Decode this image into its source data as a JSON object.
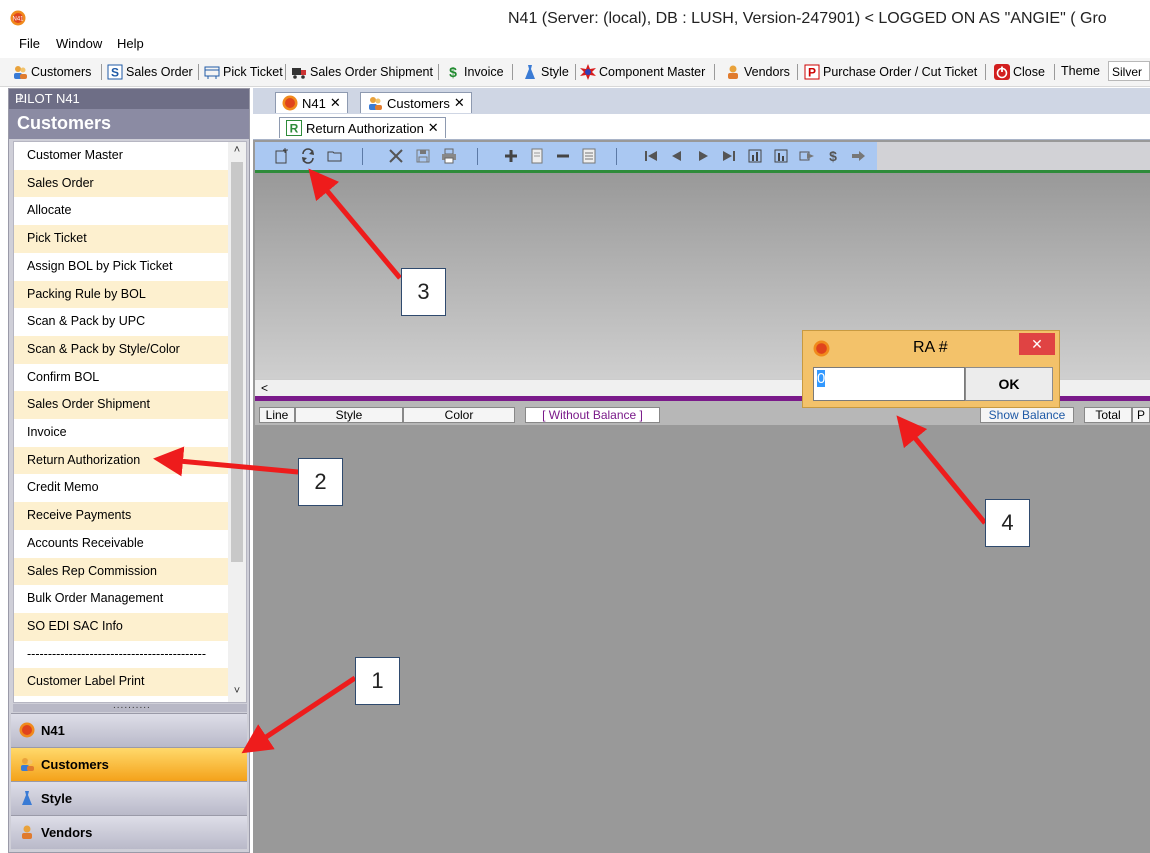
{
  "titlebar": {
    "text": "N41  (Server: (local), DB : LUSH, Version-247901)      < LOGGED ON AS \"ANGIE\" ( Gro"
  },
  "menubar": {
    "items": [
      "File",
      "Window",
      "Help"
    ]
  },
  "toolbar": {
    "items": [
      {
        "label": "Customers",
        "icon": "customers-icon"
      },
      {
        "label": "Sales Order",
        "icon": "sales-order-icon"
      },
      {
        "label": "Pick Ticket",
        "icon": "pick-ticket-icon"
      },
      {
        "label": "Sales Order Shipment",
        "icon": "shipment-icon"
      },
      {
        "label": "Invoice",
        "icon": "invoice-dollar-icon"
      },
      {
        "label": "Style",
        "icon": "style-dress-icon"
      },
      {
        "label": "Component Master",
        "icon": "component-icon"
      },
      {
        "label": "Vendors",
        "icon": "vendors-icon"
      },
      {
        "label": "Purchase Order / Cut Ticket",
        "icon": "purchase-order-icon"
      },
      {
        "label": "Close",
        "icon": "close-power-icon"
      }
    ],
    "theme_label": "Theme",
    "theme_value": "Silver"
  },
  "leftpane": {
    "header": "PILOT  N41",
    "pin": "⊥",
    "title": "Customers",
    "menu_items": [
      "Customer Master",
      "Sales Order",
      "Allocate",
      "Pick Ticket",
      "Assign BOL by Pick Ticket",
      "Packing Rule by BOL",
      "Scan & Pack by UPC",
      "Scan & Pack by Style/Color",
      "Confirm BOL",
      "Sales Order Shipment",
      "Invoice",
      "Return Authorization",
      "Credit Memo",
      "Receive Payments",
      "Accounts Receivable",
      "Sales Rep Commission",
      "Bulk Order Management",
      "SO EDI SAC Info",
      "-------------------------------------------",
      "Customer Label Print"
    ],
    "splitter": "..........",
    "nav_buttons": [
      {
        "label": "N41",
        "icon": "n41-logo-icon",
        "active": false
      },
      {
        "label": "Customers",
        "icon": "customers-icon",
        "active": true
      },
      {
        "label": "Style",
        "icon": "style-dress-icon",
        "active": false
      },
      {
        "label": "Vendors",
        "icon": "vendors-icon",
        "active": false
      }
    ]
  },
  "doctabs": [
    {
      "label": "N41",
      "close": "✕"
    },
    {
      "label": "Customers",
      "close": "✕"
    }
  ],
  "subtab": {
    "label": "Return Authorization",
    "close": "✕"
  },
  "grid_headers": {
    "line": "Line",
    "style": "Style",
    "color": "Color",
    "without_balance": "[ Without Balance ]",
    "show_balance": "Show Balance",
    "total": "Total",
    "p": "P"
  },
  "hscroll_arrow": "<",
  "dialog": {
    "title": "RA #",
    "close": "✕",
    "input_value": "0",
    "ok_label": "OK"
  },
  "callouts": [
    "1",
    "2",
    "3",
    "4"
  ],
  "colors": {
    "accent_active": "#f4a21a",
    "toolbar_blue": "#aac8f2",
    "purple_line": "#7a1a8a",
    "dialog_bg": "#f3c26a",
    "arrow_red": "#ee1c1c"
  }
}
